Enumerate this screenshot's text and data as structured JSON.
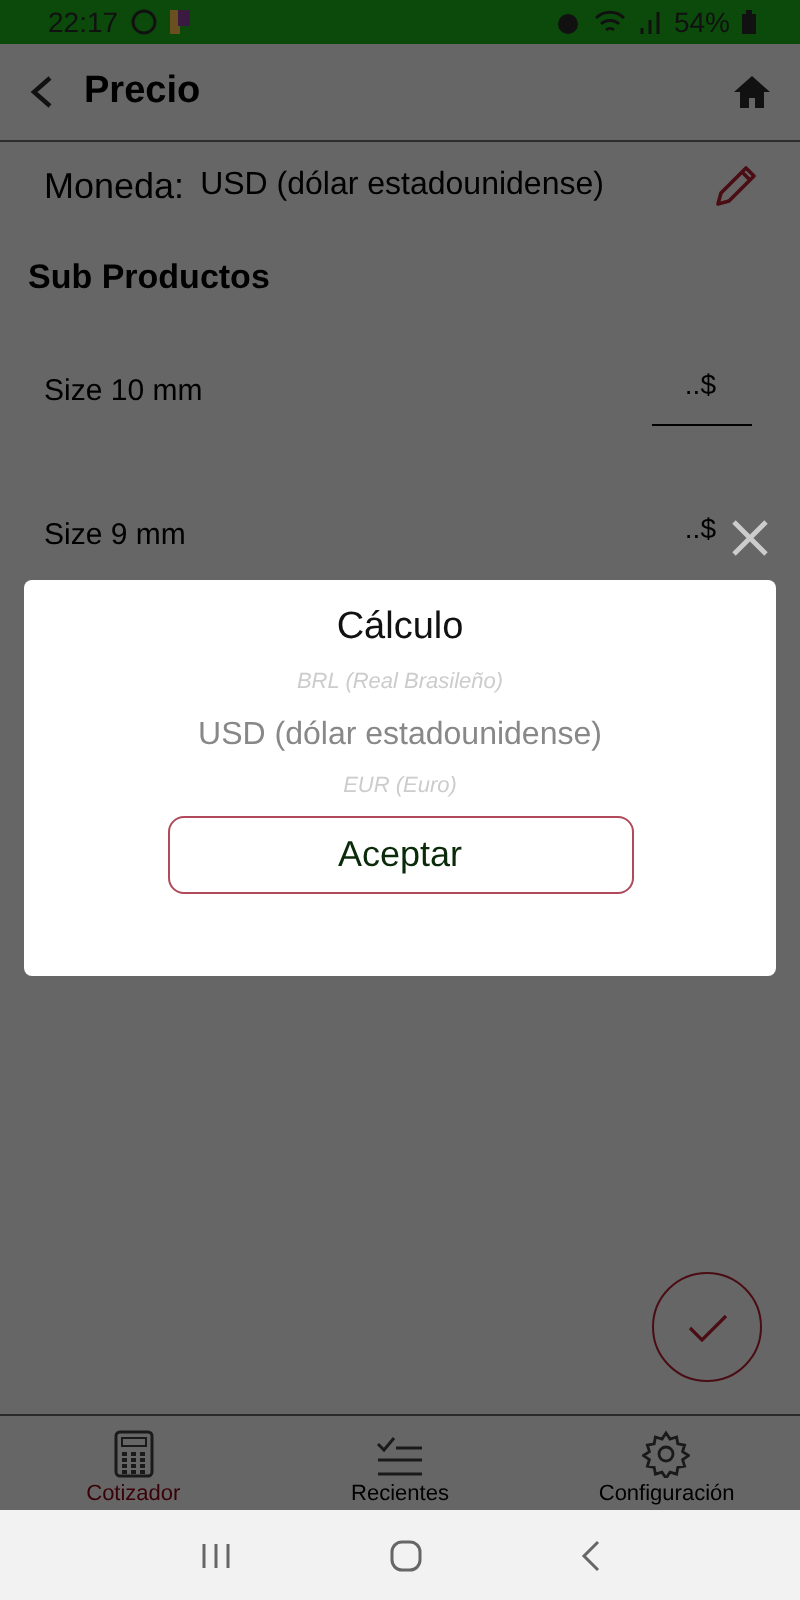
{
  "status_bar": {
    "time": "22:17",
    "battery": "54%"
  },
  "header": {
    "title": "Precio"
  },
  "currency_row": {
    "label": "Moneda:",
    "value": "USD (dólar estadounidense)"
  },
  "section_title": "Sub Productos",
  "sub_products": [
    {
      "name": "Size 10 mm",
      "placeholder": "..$",
      "focused": true
    },
    {
      "name": "Size 9 mm",
      "placeholder": "..$",
      "focused": false
    }
  ],
  "dialog": {
    "title": "Cálculo",
    "options": [
      {
        "label": "BRL (Real Brasileño)",
        "selected": false
      },
      {
        "label": "USD (dólar estadounidense)",
        "selected": true
      },
      {
        "label": "EUR (Euro)",
        "selected": false
      }
    ],
    "button": "Aceptar"
  },
  "bottom_nav": [
    {
      "label": "Cotizador",
      "kind": "calculator",
      "selected": true
    },
    {
      "label": "Recientes",
      "kind": "checklist",
      "selected": false
    },
    {
      "label": "Configuración",
      "kind": "settings",
      "selected": false
    }
  ]
}
